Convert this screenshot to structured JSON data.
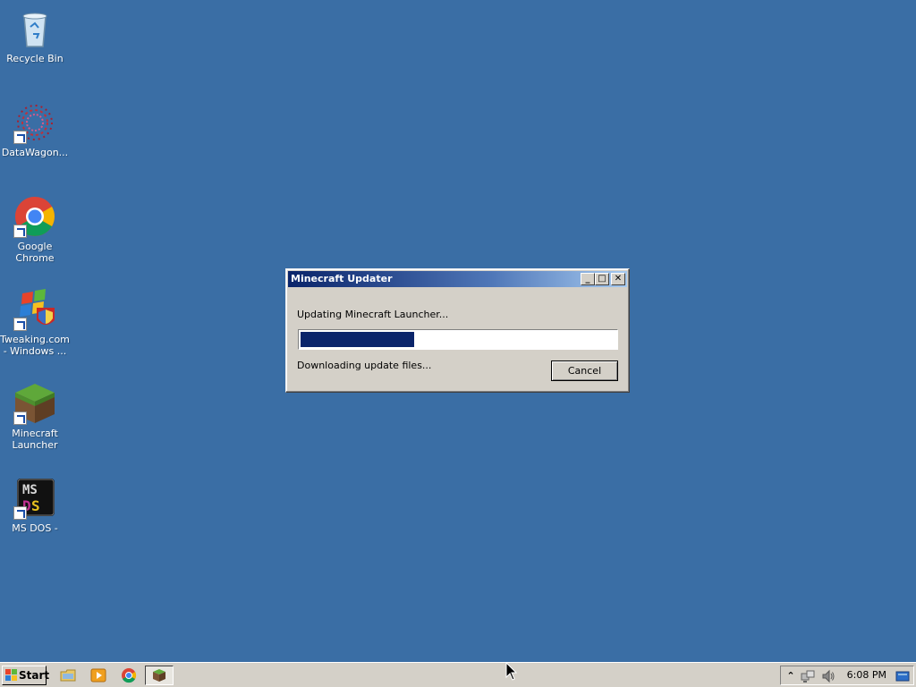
{
  "desktop": {
    "icons": [
      {
        "label": "Recycle Bin",
        "icon": "recycle-bin-icon"
      },
      {
        "label": "DataWagon...",
        "icon": "datawagon-icon"
      },
      {
        "label": "Google Chrome",
        "icon": "chrome-icon"
      },
      {
        "label": "Tweaking.com - Windows ...",
        "icon": "tweaking-icon"
      },
      {
        "label": "Minecraft Launcher",
        "icon": "minecraft-icon"
      },
      {
        "label": "MS DOS -",
        "icon": "msdos-icon"
      }
    ]
  },
  "dialog": {
    "title": "Minecraft Updater",
    "status_text": "Updating Minecraft Launcher...",
    "progress": 0.36,
    "detail_text": "Downloading update files...",
    "cancel_label": "Cancel",
    "minimize_glyph": "_",
    "maximize_glyph": "□",
    "close_glyph": "✕"
  },
  "taskbar": {
    "start_label": "Start",
    "clock": "6:08 PM",
    "tray_expand_glyph": "⌃",
    "quick_launch": [
      "file-explorer-icon",
      "media-player-icon",
      "chrome-icon"
    ],
    "open_windows": [
      "minecraft-icon"
    ]
  },
  "colors": {
    "desktop": "#3a6ea5",
    "title_bar": "#0a246a",
    "progress_fill": "#0a246a"
  }
}
